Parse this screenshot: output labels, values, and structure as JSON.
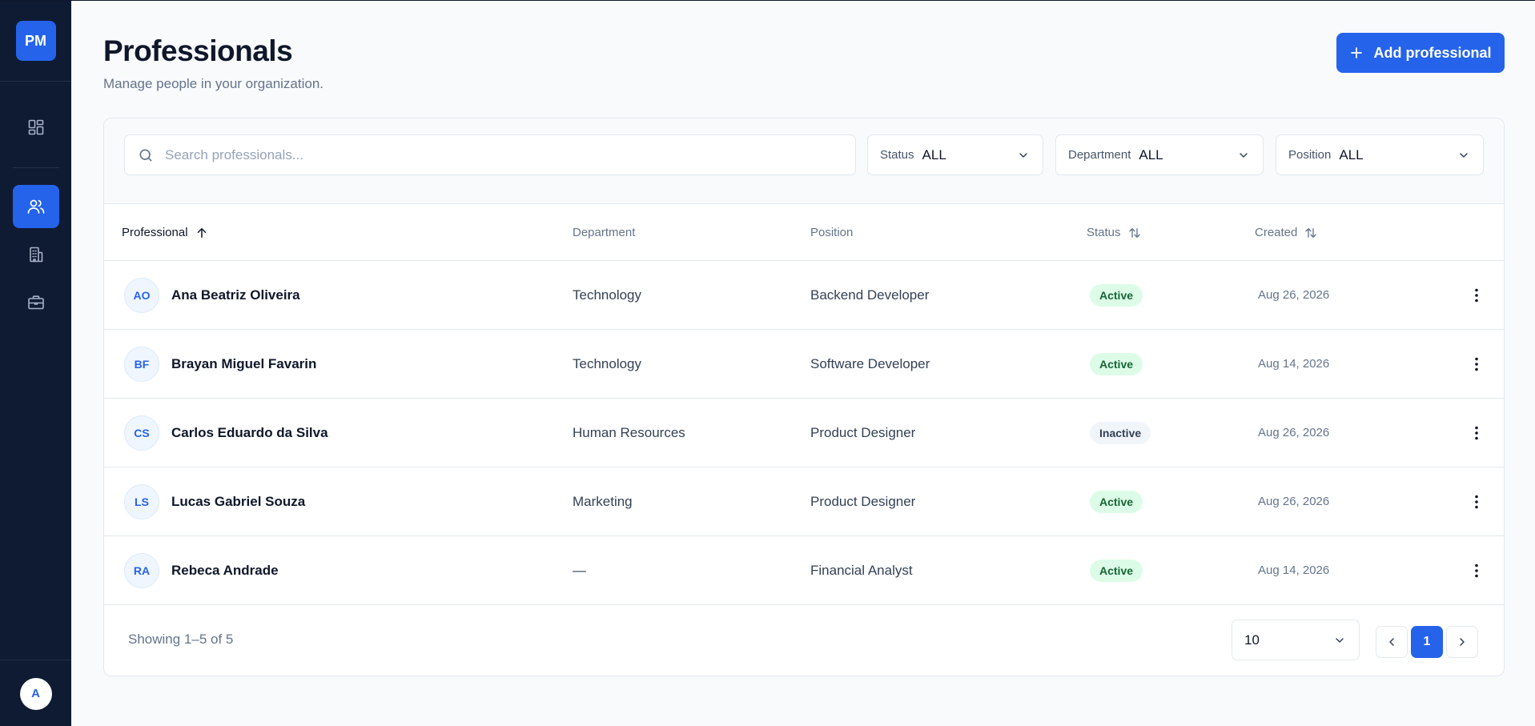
{
  "sidebar": {
    "logo": "PM",
    "nav": [
      {
        "icon": "dashboard-icon",
        "active": false
      },
      {
        "icon": "users-icon",
        "active": true
      },
      {
        "icon": "building-icon",
        "active": false
      },
      {
        "icon": "briefcase-icon",
        "active": false
      }
    ],
    "user_initial": "A"
  },
  "header": {
    "title": "Professionals",
    "subtitle": "Manage people in your organization.",
    "add_label": "Add professional"
  },
  "filters": {
    "search_placeholder": "Search professionals...",
    "status": {
      "label": "Status",
      "value": "ALL"
    },
    "department": {
      "label": "Department",
      "value": "ALL"
    },
    "position": {
      "label": "Position",
      "value": "ALL"
    }
  },
  "table": {
    "columns": {
      "professional": "Professional",
      "department": "Department",
      "position": "Position",
      "status": "Status",
      "created": "Created"
    },
    "rows": [
      {
        "initials": "AO",
        "name": "Ana Beatriz Oliveira",
        "department": "Technology",
        "position": "Backend Developer",
        "status": "Active",
        "created": "Aug 26, 2026"
      },
      {
        "initials": "BF",
        "name": "Brayan Miguel Favarin",
        "department": "Technology",
        "position": "Software Developer",
        "status": "Active",
        "created": "Aug 14, 2026"
      },
      {
        "initials": "CS",
        "name": "Carlos Eduardo da Silva",
        "department": "Human Resources",
        "position": "Product Designer",
        "status": "Inactive",
        "created": "Aug 26, 2026"
      },
      {
        "initials": "LS",
        "name": "Lucas Gabriel Souza",
        "department": "Marketing",
        "position": "Product Designer",
        "status": "Active",
        "created": "Aug 26, 2026"
      },
      {
        "initials": "RA",
        "name": "Rebeca Andrade",
        "department": "—",
        "position": "Financial Analyst",
        "status": "Active",
        "created": "Aug 14, 2026"
      }
    ]
  },
  "footer": {
    "showing": "Showing 1–5 of 5",
    "page_size": "10",
    "current_page": "1"
  },
  "colors": {
    "accent": "#2563eb",
    "sidebar_bg": "#0f1b33",
    "active_badge_bg": "#dcfce7",
    "active_badge_text": "#166534"
  }
}
